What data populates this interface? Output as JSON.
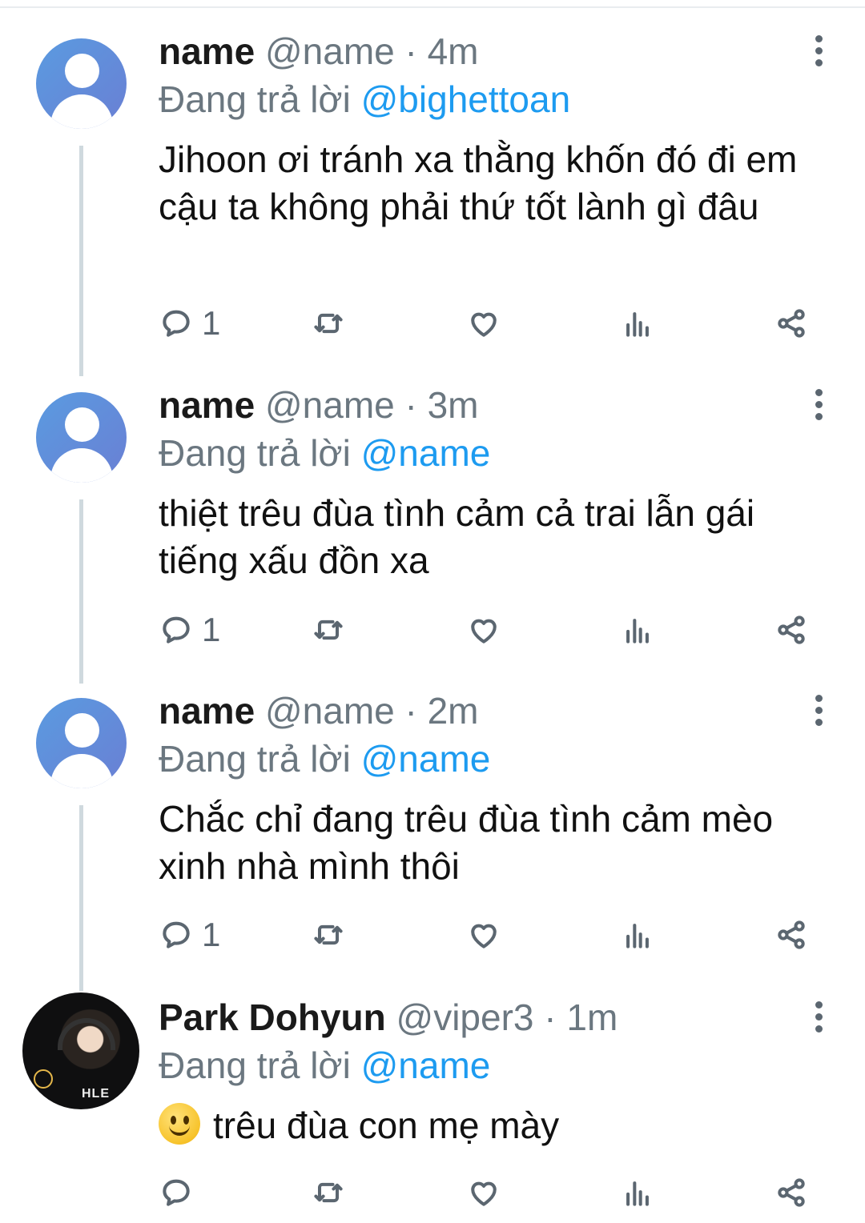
{
  "replies": [
    {
      "name": "name",
      "handle": "@name",
      "time": "· 4m",
      "reply_prefix": "Đang trả lời",
      "reply_to": "@bighettoan",
      "text": "Jihoon ơi tránh xa thằng khốn đó đi em cậu ta không phải thứ tốt lành gì đâu",
      "reply_count": "1",
      "avatar": "default-avatar"
    },
    {
      "name": "name",
      "handle": "@name",
      "time": "· 3m",
      "reply_prefix": "Đang trả lời",
      "reply_to": "@name",
      "text": "thiệt trêu đùa tình cảm cả trai lẫn gái tiếng xấu đồn xa",
      "reply_count": "1",
      "avatar": "default-avatar"
    },
    {
      "name": "name",
      "handle": "@name",
      "time": "· 2m",
      "reply_prefix": "Đang trả lời",
      "reply_to": "@name",
      "text": "Chắc chỉ đang trêu đùa tình cảm mèo xinh nhà mình thôi",
      "reply_count": "1",
      "avatar": "default-avatar"
    },
    {
      "name": "Park Dohyun",
      "handle": "@viper3",
      "time": "· 1m",
      "reply_prefix": "Đang trả lời",
      "reply_to": "@name",
      "emoji": "slightly-smiling-face",
      "text": "trêu đùa con mẹ mày",
      "reply_count": "",
      "avatar": "photo-avatar",
      "avatar_caption": "HLE"
    }
  ],
  "icons": [
    "comment-icon",
    "retweet-icon",
    "like-icon",
    "analytics-icon",
    "share-icon",
    "more-options-icon"
  ],
  "colors": {
    "link": "#1d9bf0",
    "muted": "#6b7780",
    "icon": "#5b6670",
    "thread_line": "#cfd9de"
  }
}
